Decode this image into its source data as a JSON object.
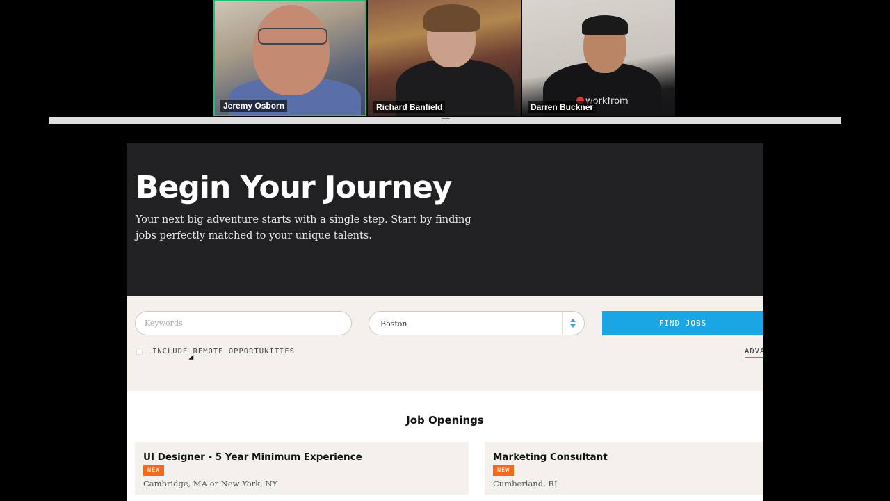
{
  "participants": [
    {
      "name": "Jeremy Osborn",
      "active": true
    },
    {
      "name": "Richard Banfield",
      "active": false
    },
    {
      "name": "Darren Buckner",
      "active": false
    }
  ],
  "shirt_text": "workfrom",
  "colors": {
    "active_border": "#1fbf75",
    "accent_blue": "#1aa6e4",
    "badge_orange": "#f26b1d",
    "hero_bg": "#212124"
  },
  "hero": {
    "title": "Begin Your Journey",
    "subtitle": "Your next big adventure starts with a single step. Start by finding jobs perfectly matched to your unique talents."
  },
  "search": {
    "keywords_placeholder": "Keywords",
    "location_value": "Boston",
    "find_label": "FIND JOBS",
    "remote_label": "INCLUDE REMOTE OPPORTUNITIES",
    "remote_checked": false,
    "advanced_label": "ADVA"
  },
  "jobs": {
    "title": "Job Openings",
    "items": [
      {
        "title": "UI Designer - 5 Year Minimum Experience",
        "badge": "NEW",
        "location": "Cambridge, MA or New York, NY"
      },
      {
        "title": "Marketing Consultant",
        "badge": "NEW",
        "location": "Cumberland, RI"
      }
    ]
  }
}
